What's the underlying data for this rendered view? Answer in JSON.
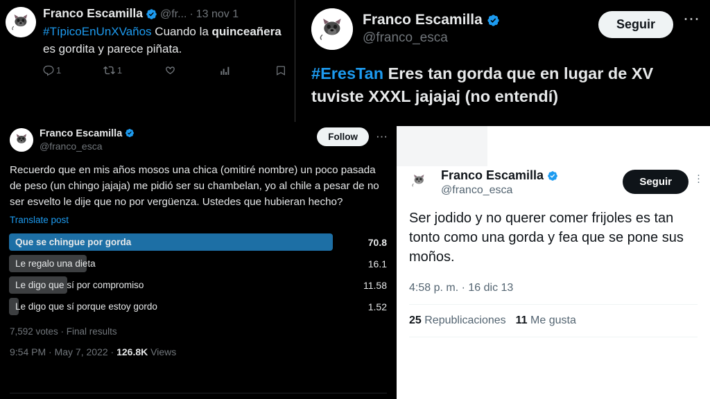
{
  "colors": {
    "dark_bg": "#000000",
    "light_bg": "#ffffff",
    "twitter_blue": "#1d9bf0",
    "verified_blue": "#1d9bf0",
    "poll_lead_bar": "#1d6fa5",
    "poll_rest_bar": "#3d3f41",
    "muted_dark": "#71767b",
    "muted_light": "#536471"
  },
  "panel_top_left": {
    "display_name": "Franco Escamilla",
    "handle": "@fr...",
    "separator": "·",
    "date": "13 nov 1",
    "verified_icon": "verified-badge-icon",
    "avatar_icon": "avatar-bulldog-icon",
    "tweet": {
      "hashtag": "#TípicoEnUnXVaños",
      "text_before_bold": "Cuando la ",
      "bold_text": "quinceañera",
      "text_after_bold": " es gordita y parece piñata."
    },
    "actions": [
      {
        "icon": "reply-icon",
        "count": "1"
      },
      {
        "icon": "retweet-icon",
        "count": "1"
      },
      {
        "icon": "like-icon",
        "count": ""
      },
      {
        "icon": "views-analytics-icon",
        "count": ""
      },
      {
        "icon": "bookmark-icon",
        "count": ""
      }
    ]
  },
  "panel_top_right": {
    "display_name": "Franco Escamilla",
    "handle": "@franco_esca",
    "verified_icon": "verified-badge-icon",
    "avatar_icon": "avatar-bulldog-icon",
    "follow_label": "Seguir",
    "more_icon": "more-horizontal-icon",
    "tweet": {
      "hashtag": "#EresTan",
      "text": "Eres tan gorda que en lugar de XV tuviste XXXL  jajajaj (no entendí)"
    }
  },
  "panel_bottom_left": {
    "display_name": "Franco Escamilla",
    "handle": "@franco_esca",
    "verified_icon": "verified-badge-icon",
    "avatar_icon": "avatar-bulldog-icon",
    "follow_label": "Follow",
    "more_icon": "more-horizontal-icon",
    "tweet_text": "Recuerdo que en mis años mosos una chica (omitiré nombre) un poco pasada de peso (un chingo jajaja) me pidió ser su chambelan, yo al chile a pesar de no ser esvelto le dije que no por vergüenza. Ustedes que hubieran hecho?",
    "translate_label": "Translate post",
    "poll": {
      "options": [
        {
          "label": "Que se chingue por gorda",
          "percent": "70.8",
          "width_pct": 100,
          "winner": true
        },
        {
          "label": "Le regalo una dieta",
          "percent": "16.1",
          "width_pct": 24,
          "winner": false
        },
        {
          "label": "Le digo que sí por compromiso",
          "percent": "11.58",
          "width_pct": 18,
          "winner": false
        },
        {
          "label": "Le digo que sí porque estoy gordo",
          "percent": "1.52",
          "width_pct": 3,
          "winner": false
        }
      ],
      "summary": "7,592 votes · Final results"
    },
    "timestamp_time": "9:54 PM",
    "timestamp_sep1": " · ",
    "timestamp_date": "May 7, 2022",
    "timestamp_sep2": " · ",
    "views_count": "126.8K",
    "views_label": " Views"
  },
  "panel_bottom_right": {
    "display_name": "Franco Escamilla",
    "handle": "@franco_esca",
    "verified_icon": "verified-badge-icon",
    "avatar_icon": "avatar-bulldog-icon",
    "follow_label": "Seguir",
    "kebab_icon": "more-vertical-icon",
    "tweet_text": "Ser jodido y no querer comer frijoles es tan tonto como una gorda y fea que se pone sus moños.",
    "timestamp": "4:58 p. m. · 16 dic 13",
    "metrics": [
      {
        "count": "25",
        "label": "Republicaciones"
      },
      {
        "count": "11",
        "label": "Me gusta"
      }
    ]
  }
}
